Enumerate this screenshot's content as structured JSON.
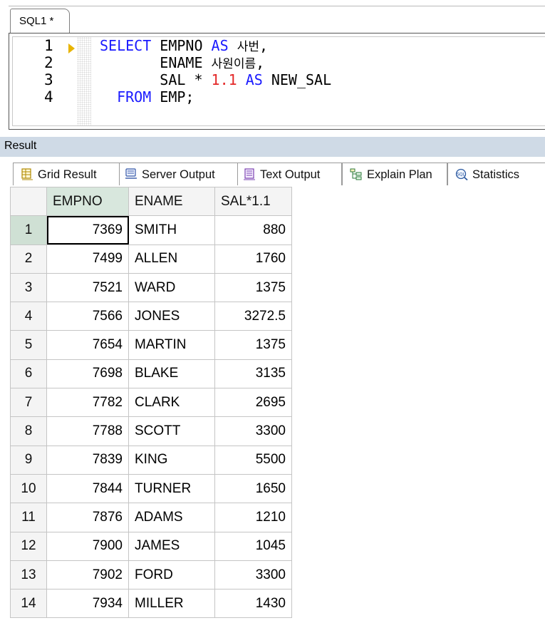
{
  "editor": {
    "tab_label": "SQL1 *",
    "line_numbers": [
      "1",
      "2",
      "3",
      "4"
    ],
    "lines": [
      [
        {
          "t": "SELECT",
          "c": "kw"
        },
        {
          "t": " EMPNO ",
          "c": ""
        },
        {
          "t": "AS",
          "c": "kw"
        },
        {
          "t": " ",
          "c": ""
        },
        {
          "t": "사번",
          "c": "ko"
        },
        {
          "t": ",",
          "c": ""
        }
      ],
      [
        {
          "t": "       ENAME ",
          "c": ""
        },
        {
          "t": "사원이름",
          "c": "ko"
        },
        {
          "t": ",",
          "c": ""
        }
      ],
      [
        {
          "t": "       SAL * ",
          "c": ""
        },
        {
          "t": "1.1",
          "c": "num"
        },
        {
          "t": " ",
          "c": ""
        },
        {
          "t": "AS",
          "c": "kw"
        },
        {
          "t": " NEW_SAL",
          "c": ""
        }
      ],
      [
        {
          "t": "  ",
          "c": ""
        },
        {
          "t": "FROM",
          "c": "kw"
        },
        {
          "t": " EMP;",
          "c": ""
        }
      ]
    ]
  },
  "result": {
    "title": "Result",
    "tabs": [
      {
        "label": "Grid Result",
        "icon": "grid-result-icon"
      },
      {
        "label": "Server Output",
        "icon": "server-output-icon"
      },
      {
        "label": "Text Output",
        "icon": "text-output-icon"
      },
      {
        "label": "Explain Plan",
        "icon": "explain-plan-icon"
      },
      {
        "label": "Statistics",
        "icon": "statistics-icon"
      }
    ]
  },
  "grid": {
    "columns": [
      "EMPNO",
      "ENAME",
      "SAL*1.1"
    ],
    "rows": [
      {
        "n": "1",
        "empno": "7369",
        "ename": "SMITH",
        "sal": "880"
      },
      {
        "n": "2",
        "empno": "7499",
        "ename": "ALLEN",
        "sal": "1760"
      },
      {
        "n": "3",
        "empno": "7521",
        "ename": "WARD",
        "sal": "1375"
      },
      {
        "n": "4",
        "empno": "7566",
        "ename": "JONES",
        "sal": "3272.5"
      },
      {
        "n": "5",
        "empno": "7654",
        "ename": "MARTIN",
        "sal": "1375"
      },
      {
        "n": "6",
        "empno": "7698",
        "ename": "BLAKE",
        "sal": "3135"
      },
      {
        "n": "7",
        "empno": "7782",
        "ename": "CLARK",
        "sal": "2695"
      },
      {
        "n": "8",
        "empno": "7788",
        "ename": "SCOTT",
        "sal": "3300"
      },
      {
        "n": "9",
        "empno": "7839",
        "ename": "KING",
        "sal": "5500"
      },
      {
        "n": "10",
        "empno": "7844",
        "ename": "TURNER",
        "sal": "1650"
      },
      {
        "n": "11",
        "empno": "7876",
        "ename": "ADAMS",
        "sal": "1210"
      },
      {
        "n": "12",
        "empno": "7900",
        "ename": "JAMES",
        "sal": "1045"
      },
      {
        "n": "13",
        "empno": "7902",
        "ename": "FORD",
        "sal": "3300"
      },
      {
        "n": "14",
        "empno": "7934",
        "ename": "MILLER",
        "sal": "1430"
      }
    ]
  },
  "colors": {
    "keyword": "#1a1aff",
    "number_literal": "#e32626",
    "result_header_bg": "#cfdae6",
    "selected_header_bg": "#d8e7dd"
  }
}
